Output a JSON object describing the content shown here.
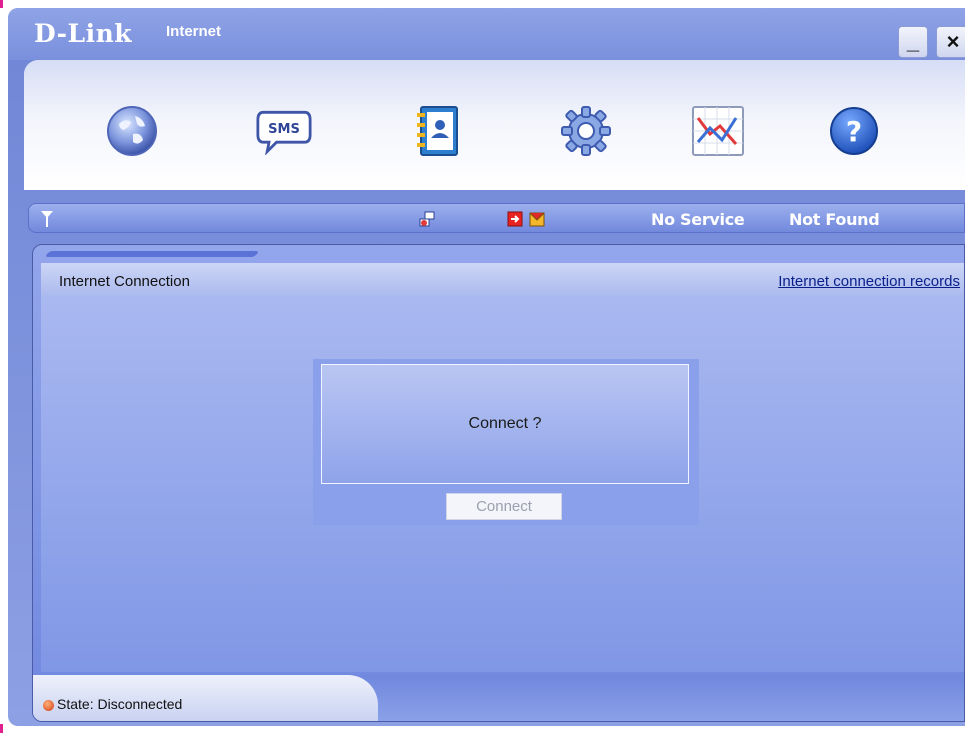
{
  "app": {
    "brand": "D-Link",
    "brand_app": "Internet"
  },
  "window_controls": {
    "minimize": "_",
    "close": "×"
  },
  "toolbar": {
    "items": [
      {
        "icon": "globe-icon",
        "name": "internet"
      },
      {
        "icon": "sms-bubble-icon",
        "label": "SMS",
        "name": "sms"
      },
      {
        "icon": "contacts-book-icon",
        "name": "phonebook"
      },
      {
        "icon": "gear-icon",
        "name": "settings"
      },
      {
        "icon": "statistics-chart-icon",
        "name": "statistics"
      },
      {
        "icon": "help-icon",
        "label": "?",
        "name": "help"
      }
    ]
  },
  "status_strip": {
    "signal_icon": "antenna-icon",
    "network_icon": "network-connection-icon",
    "sim_icon": "sim-out-icon",
    "message_icon": "sms-mailbox-icon",
    "service": "No Service",
    "device": "Not Found"
  },
  "panel": {
    "title": "Internet Connection",
    "records_link": "Internet connection records"
  },
  "dialog": {
    "message": "Connect ?",
    "button": "Connect"
  },
  "statusbar": {
    "state": "State: Disconnected"
  },
  "colors": {
    "accent": "#7a90dd",
    "link": "#0a1f8a",
    "disconnected": "#d23c12"
  }
}
